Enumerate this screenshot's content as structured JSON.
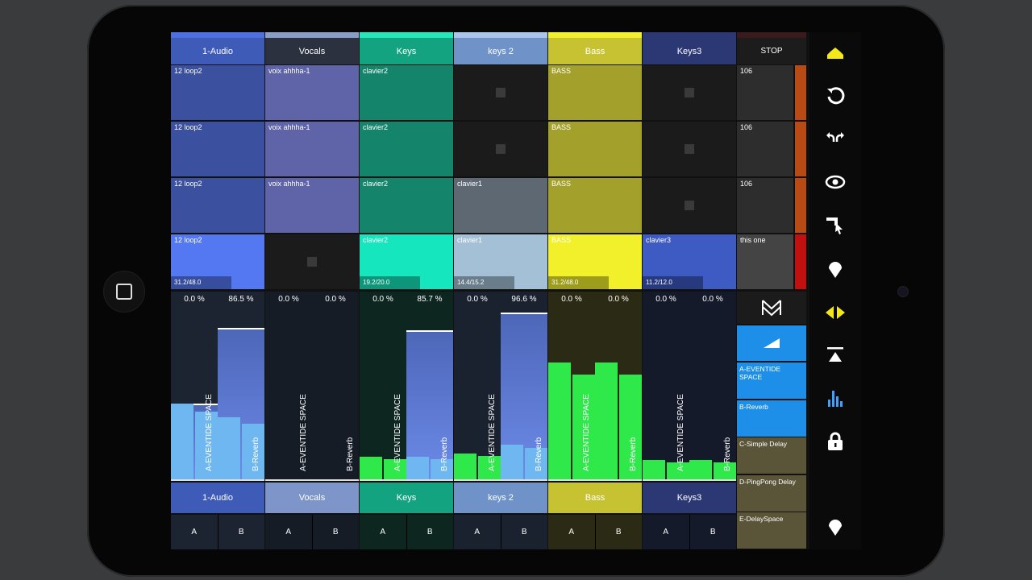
{
  "tracks": [
    {
      "name": "1-Audio",
      "hdr": "#3f5bb8",
      "hdrbar": "#4e6fe0",
      "footer": "#3f5bb8",
      "mixbg": "#1c2431",
      "clips": [
        {
          "label": "12 loop2",
          "color": "#3c50a0"
        },
        {
          "label": "12 loop2",
          "color": "#3c50a0"
        },
        {
          "label": "12 loop2",
          "color": "#3c50a0"
        },
        {
          "label": "12 loop2",
          "color": "#5378f2",
          "progress": "31.2/48.0",
          "active": true
        }
      ],
      "volA": "0.0 %",
      "volB": "86.5 %",
      "fillA": 0.45,
      "fillB": 0.89,
      "meterA": 0.45,
      "meterB": 0.37,
      "sendA": "A-EVENTIDE SPACE",
      "sendB": "B-Reverb"
    },
    {
      "name": "Vocals",
      "hdr": "#2c3140",
      "hdrbar": "#8a9dc4",
      "footer": "#7d95c9",
      "mixbg": "#151c26",
      "clips": [
        {
          "label": "voix ahhha-1",
          "color": "#5f63a8"
        },
        {
          "label": "voix ahhha-1",
          "color": "#5f63a8"
        },
        {
          "label": "voix ahhha-1",
          "color": "#5f63a8"
        },
        {
          "label": "",
          "color": "#1b1b1b",
          "stop": true
        }
      ],
      "volA": "0.0 %",
      "volB": "0.0 %",
      "fillA": 0.0,
      "fillB": 0.0,
      "meterA": 0.0,
      "meterB": 0.0,
      "sendA": "A-EVENTIDE SPACE",
      "sendB": "B-Reverb"
    },
    {
      "name": "Keys",
      "hdr": "#14a381",
      "hdrbar": "#27e6bb",
      "footer": "#14a381",
      "mixbg": "#0e2620",
      "clips": [
        {
          "label": "clavier2",
          "color": "#14856b"
        },
        {
          "label": "clavier2",
          "color": "#14856b"
        },
        {
          "label": "clavier2",
          "color": "#14856b"
        },
        {
          "label": "clavier2",
          "color": "#16e6bd",
          "progress": "19.2/20.0",
          "active": true
        }
      ],
      "volA": "0.0 %",
      "volB": "85.7 %",
      "fillA": 0.0,
      "fillB": 0.88,
      "meterA": 0.14,
      "meterB": 0.14,
      "sendA": "A-EVENTIDE SPACE",
      "sendB": "B-Reverb"
    },
    {
      "name": "keys 2",
      "hdr": "#6f93c9",
      "hdrbar": "#a9c6ea",
      "footer": "#6f93c9",
      "mixbg": "#1a2230",
      "clips": [
        {
          "label": "",
          "color": "#1b1b1b",
          "stop": true
        },
        {
          "label": "",
          "color": "#1b1b1b",
          "stop": true
        },
        {
          "label": "clavier1",
          "color": "#5d6873"
        },
        {
          "label": "clavier1",
          "color": "#a3c0d6",
          "progress": "14.4/15.2",
          "active": true
        }
      ],
      "volA": "0.0 %",
      "volB": "96.6 %",
      "fillA": 0.0,
      "fillB": 0.98,
      "meterA": 0.16,
      "meterB": 0.21,
      "sendA": "A-EVENTIDE SPACE",
      "sendB": "B-Reverb"
    },
    {
      "name": "Bass",
      "hdr": "#c7c231",
      "hdrbar": "#f2ef2c",
      "footer": "#c7c231",
      "mixbg": "#2b2a14",
      "clips": [
        {
          "label": "BASS",
          "color": "#a3a02b"
        },
        {
          "label": "BASS",
          "color": "#a3a02b"
        },
        {
          "label": "BASS",
          "color": "#a3a02b"
        },
        {
          "label": "BASS",
          "color": "#f2f02a",
          "progress": "31.2/48.0",
          "active": true
        }
      ],
      "volA": "0.0 %",
      "volB": "0.0 %",
      "fillA": 0.0,
      "fillB": 0.0,
      "meterA": 0.69,
      "meterB": 0.69,
      "sendA": "A-EVENTIDE SPACE",
      "sendB": "B-Reverb"
    },
    {
      "name": "Keys3",
      "hdr": "#2c3874",
      "hdrbar": "#2c3874",
      "footer": "#2c3874",
      "mixbg": "#151a2a",
      "clips": [
        {
          "label": "",
          "color": "#1b1b1b",
          "stop": true
        },
        {
          "label": "",
          "color": "#1b1b1b",
          "stop": true
        },
        {
          "label": "",
          "color": "#1b1b1b",
          "stop": true
        },
        {
          "label": "clavier3",
          "color": "#3e5ac3",
          "progress": "11.2/12.0",
          "active": true
        }
      ],
      "volA": "0.0 %",
      "volB": "0.0 %",
      "fillA": 0.0,
      "fillB": 0.0,
      "meterA": 0.12,
      "meterB": 0.12,
      "sendA": "A-EVENTIDE SPACE",
      "sendB": "B-Reverb"
    }
  ],
  "master": {
    "stop_label": "STOP",
    "scenes": [
      {
        "label": "106"
      },
      {
        "label": "106"
      },
      {
        "label": "106"
      },
      {
        "label": "this one"
      }
    ],
    "scene_colors": [
      "#b84a15",
      "#b84a15",
      "#b84a15",
      "#c01010"
    ]
  },
  "ab_labels": {
    "a": "A",
    "b": "B"
  },
  "fx_slots": [
    {
      "label": "A-EVENTIDE SPACE",
      "color": "#1e8fe8"
    },
    {
      "label": "B-Reverb",
      "color": "#1e8fe8"
    },
    {
      "label": "C-Simple Delay",
      "color": "#5a5438"
    },
    {
      "label": "D-PingPong Delay",
      "color": "#5a5438"
    },
    {
      "label": "E-DelaySpace",
      "color": "#5a5438"
    }
  ],
  "toolbar_icons": [
    "session-icon",
    "undo-icon",
    "redo-icon",
    "view-icon",
    "select-tool-icon",
    "marker-icon",
    "nudge-icon",
    "crossfade-icon",
    "mixer-icon",
    "lock-icon",
    "marker-bottom-icon"
  ],
  "accent": "#f2e81a",
  "mixer_blue": "#3fa0ff"
}
